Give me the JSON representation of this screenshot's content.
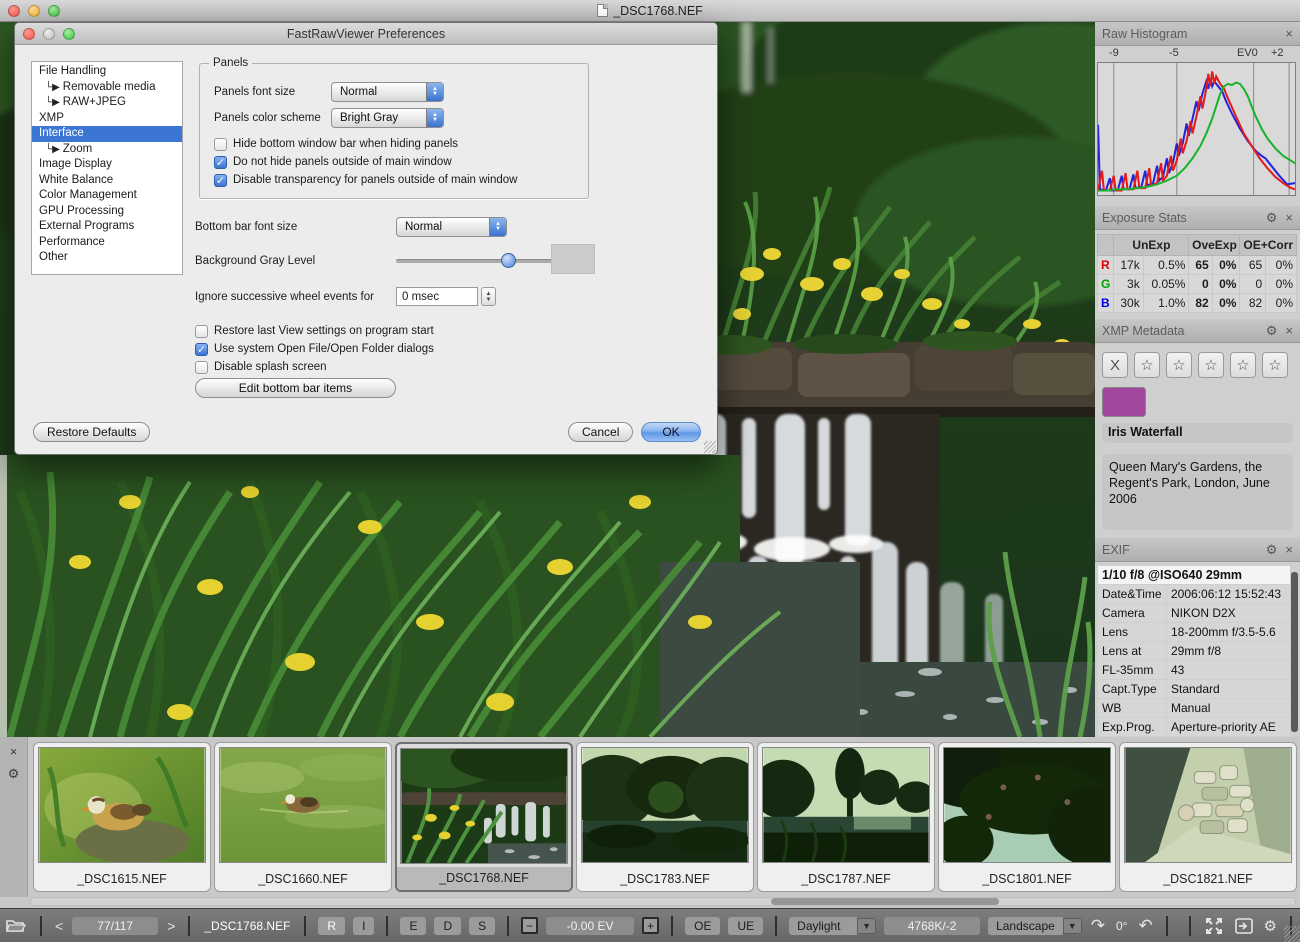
{
  "icons": {
    "gear": "⚙",
    "close": "×",
    "star": "☆",
    "clear": "X",
    "check": "✓",
    "branch": "└▶",
    "prev": "<",
    "next": ">",
    "minus": "−",
    "plus": "+",
    "dropdown": "▼",
    "up": "▲",
    "down": "▼",
    "rotate_cw": "↷",
    "rotate_ccw": "↶"
  },
  "window": {
    "title": "_DSC1768.NEF"
  },
  "dialog": {
    "title": "FastRawViewer Preferences",
    "nav": [
      {
        "label": "File Handling",
        "indent": 0,
        "selected": false
      },
      {
        "label": "Removable media",
        "indent": 1,
        "selected": false
      },
      {
        "label": "RAW+JPEG",
        "indent": 1,
        "selected": false
      },
      {
        "label": "XMP",
        "indent": 0,
        "selected": false
      },
      {
        "label": "Interface",
        "indent": 0,
        "selected": true
      },
      {
        "label": "Zoom",
        "indent": 1,
        "selected": false
      },
      {
        "label": "Image Display",
        "indent": 0,
        "selected": false
      },
      {
        "label": "White Balance",
        "indent": 0,
        "selected": false
      },
      {
        "label": "Color Management",
        "indent": 0,
        "selected": false
      },
      {
        "label": "GPU Processing",
        "indent": 0,
        "selected": false
      },
      {
        "label": "External Programs",
        "indent": 0,
        "selected": false
      },
      {
        "label": "Performance",
        "indent": 0,
        "selected": false
      },
      {
        "label": "Other",
        "indent": 0,
        "selected": false
      }
    ],
    "panels_group": {
      "title": "Panels",
      "font_size_label": "Panels font size",
      "font_size_value": "Normal",
      "color_scheme_label": "Panels color scheme",
      "color_scheme_value": "Bright Gray",
      "checkboxes": [
        {
          "label": "Hide bottom window bar when hiding panels",
          "checked": false
        },
        {
          "label": "Do not hide panels outside of main window",
          "checked": true
        },
        {
          "label": "Disable transparency for panels outside of main window",
          "checked": true
        }
      ]
    },
    "bottom_bar_font_label": "Bottom bar font size",
    "bottom_bar_font_value": "Normal",
    "bg_gray_label": "Background Gray Level",
    "wheel_label": "Ignore successive wheel events for",
    "wheel_value": "0 msec",
    "general_checkboxes": [
      {
        "label": "Restore last View settings on program start",
        "checked": false
      },
      {
        "label": "Use system Open File/Open Folder dialogs",
        "checked": true
      },
      {
        "label": "Disable splash screen",
        "checked": false
      }
    ],
    "edit_bottom_button": "Edit bottom bar items",
    "restore_button": "Restore Defaults",
    "cancel_button": "Cancel",
    "ok_button": "OK"
  },
  "panels": {
    "histogram": {
      "title": "Raw Histogram",
      "ticks": [
        "-9",
        "-5",
        "EV0",
        "+2"
      ],
      "tick_offsets": [
        14,
        74,
        142,
        176
      ],
      "gridlines_pct": [
        8,
        40,
        79,
        97
      ],
      "series": [
        {
          "name": "blue",
          "color": "#2323dd",
          "points": [
            [
              0,
              55
            ],
            [
              1,
              3
            ],
            [
              4,
              2
            ],
            [
              6,
              12
            ],
            [
              7,
              2
            ],
            [
              10,
              2
            ],
            [
              12,
              14
            ],
            [
              13,
              3
            ],
            [
              16,
              3
            ],
            [
              18,
              15
            ],
            [
              19,
              4
            ],
            [
              22,
              5
            ],
            [
              24,
              18
            ],
            [
              25,
              6
            ],
            [
              28,
              8
            ],
            [
              30,
              22
            ],
            [
              31,
              10
            ],
            [
              33,
              13
            ],
            [
              35,
              28
            ],
            [
              36,
              16
            ],
            [
              38,
              24
            ],
            [
              40,
              40
            ],
            [
              41,
              30
            ],
            [
              43,
              40
            ],
            [
              45,
              56
            ],
            [
              46,
              46
            ],
            [
              48,
              60
            ],
            [
              50,
              74
            ],
            [
              51,
              66
            ],
            [
              53,
              80
            ],
            [
              55,
              90
            ],
            [
              56,
              84
            ],
            [
              57,
              92
            ],
            [
              58,
              86
            ],
            [
              59,
              90
            ],
            [
              61,
              86
            ],
            [
              63,
              82
            ],
            [
              65,
              74
            ],
            [
              68,
              64
            ],
            [
              72,
              52
            ],
            [
              76,
              42
            ],
            [
              80,
              34
            ],
            [
              83,
              30
            ],
            [
              85,
              28
            ],
            [
              88,
              22
            ],
            [
              92,
              14
            ],
            [
              96,
              7
            ],
            [
              100,
              8
            ]
          ]
        },
        {
          "name": "red",
          "color": "#e31b1b",
          "points": [
            [
              0,
              2
            ],
            [
              2,
              18
            ],
            [
              3,
              2
            ],
            [
              6,
              2
            ],
            [
              8,
              14
            ],
            [
              9,
              2
            ],
            [
              12,
              2
            ],
            [
              14,
              16
            ],
            [
              15,
              3
            ],
            [
              18,
              3
            ],
            [
              20,
              18
            ],
            [
              21,
              4
            ],
            [
              24,
              4
            ],
            [
              26,
              20
            ],
            [
              27,
              6
            ],
            [
              30,
              8
            ],
            [
              32,
              24
            ],
            [
              33,
              10
            ],
            [
              35,
              14
            ],
            [
              37,
              30
            ],
            [
              38,
              18
            ],
            [
              40,
              26
            ],
            [
              42,
              44
            ],
            [
              43,
              32
            ],
            [
              45,
              42
            ],
            [
              47,
              58
            ],
            [
              48,
              48
            ],
            [
              50,
              62
            ],
            [
              52,
              78
            ],
            [
              53,
              68
            ],
            [
              55,
              84
            ],
            [
              56,
              96
            ],
            [
              57,
              86
            ],
            [
              58,
              98
            ],
            [
              59,
              88
            ],
            [
              60,
              94
            ],
            [
              62,
              88
            ],
            [
              64,
              84
            ],
            [
              66,
              76
            ],
            [
              70,
              62
            ],
            [
              74,
              48
            ],
            [
              78,
              38
            ],
            [
              82,
              28
            ],
            [
              86,
              20
            ],
            [
              90,
              13
            ],
            [
              94,
              8
            ],
            [
              98,
              4
            ],
            [
              100,
              3
            ]
          ]
        },
        {
          "name": "green",
          "color": "#17b32a",
          "points": [
            [
              0,
              2
            ],
            [
              5,
              2
            ],
            [
              10,
              3
            ],
            [
              15,
              3
            ],
            [
              20,
              4
            ],
            [
              25,
              5
            ],
            [
              30,
              7
            ],
            [
              35,
              10
            ],
            [
              40,
              14
            ],
            [
              44,
              20
            ],
            [
              48,
              28
            ],
            [
              52,
              38
            ],
            [
              55,
              48
            ],
            [
              58,
              60
            ],
            [
              60,
              70
            ],
            [
              62,
              80
            ],
            [
              64,
              86
            ],
            [
              66,
              88
            ],
            [
              68,
              87
            ],
            [
              70,
              89
            ],
            [
              72,
              88
            ],
            [
              74,
              84
            ],
            [
              76,
              78
            ],
            [
              78,
              70
            ],
            [
              80,
              62
            ],
            [
              83,
              52
            ],
            [
              86,
              44
            ],
            [
              90,
              36
            ],
            [
              94,
              30
            ],
            [
              98,
              26
            ],
            [
              100,
              24
            ]
          ]
        }
      ]
    },
    "exposure": {
      "title": "Exposure Stats",
      "columns": [
        "UnExp",
        "OveExp",
        "OE+Corr"
      ],
      "rows": [
        {
          "ch": "R",
          "color": "#dd0000",
          "cells": [
            "17k",
            "0.5%",
            "65",
            "0%",
            "65",
            "0%"
          ]
        },
        {
          "ch": "G",
          "color": "#00a000",
          "cells": [
            "3k",
            "0.05%",
            "0",
            "0%",
            "0",
            "0%"
          ]
        },
        {
          "ch": "B",
          "color": "#0000dd",
          "cells": [
            "30k",
            "1.0%",
            "82",
            "0%",
            "82",
            "0%"
          ]
        }
      ]
    },
    "xmp": {
      "title": "XMP Metadata",
      "label_colors": [
        "#a5504e",
        "#a8a344",
        "#0fae3a",
        "#15898c",
        "#a1489e"
      ],
      "title_value": "Iris Waterfall",
      "description": "Queen Mary's Gardens, the Regent's Park, London, June 2006"
    },
    "exif": {
      "title": "EXIF",
      "summary": "1/10 f/8 @ISO640 29mm",
      "rows": [
        [
          "Date&Time",
          "2006:06:12 15:52:43"
        ],
        [
          "Camera",
          "NIKON D2X"
        ],
        [
          "Lens",
          "18-200mm f/3.5-5.6"
        ],
        [
          "Lens at",
          "29mm f/8"
        ],
        [
          "FL-35mm",
          "43"
        ],
        [
          "Capt.Type",
          "Standard"
        ],
        [
          "WB",
          "Manual"
        ],
        [
          "Exp.Prog.",
          "Aperture-priority AE"
        ]
      ]
    }
  },
  "filmstrip": {
    "items": [
      {
        "label": "_DSC1615.NEF",
        "selected": false
      },
      {
        "label": "_DSC1660.NEF",
        "selected": false
      },
      {
        "label": "_DSC1768.NEF",
        "selected": true
      },
      {
        "label": "_DSC1783.NEF",
        "selected": false
      },
      {
        "label": "_DSC1787.NEF",
        "selected": false
      },
      {
        "label": "_DSC1801.NEF",
        "selected": false
      },
      {
        "label": "_DSC1821.NEF",
        "selected": false
      }
    ]
  },
  "statusbar": {
    "position": "77/117",
    "filename": "_DSC1768.NEF",
    "raw_mode": "R",
    "int_mode": "I",
    "exposure_btn": "E",
    "detail_btn": "D",
    "shadow_btn": "S",
    "ev_value": "-0.00 EV",
    "oe": "OE",
    "ue": "UE",
    "wb_preset": "Daylight",
    "wb_value": "4768K/-2",
    "orientation": "Landscape",
    "angle": "0°"
  }
}
